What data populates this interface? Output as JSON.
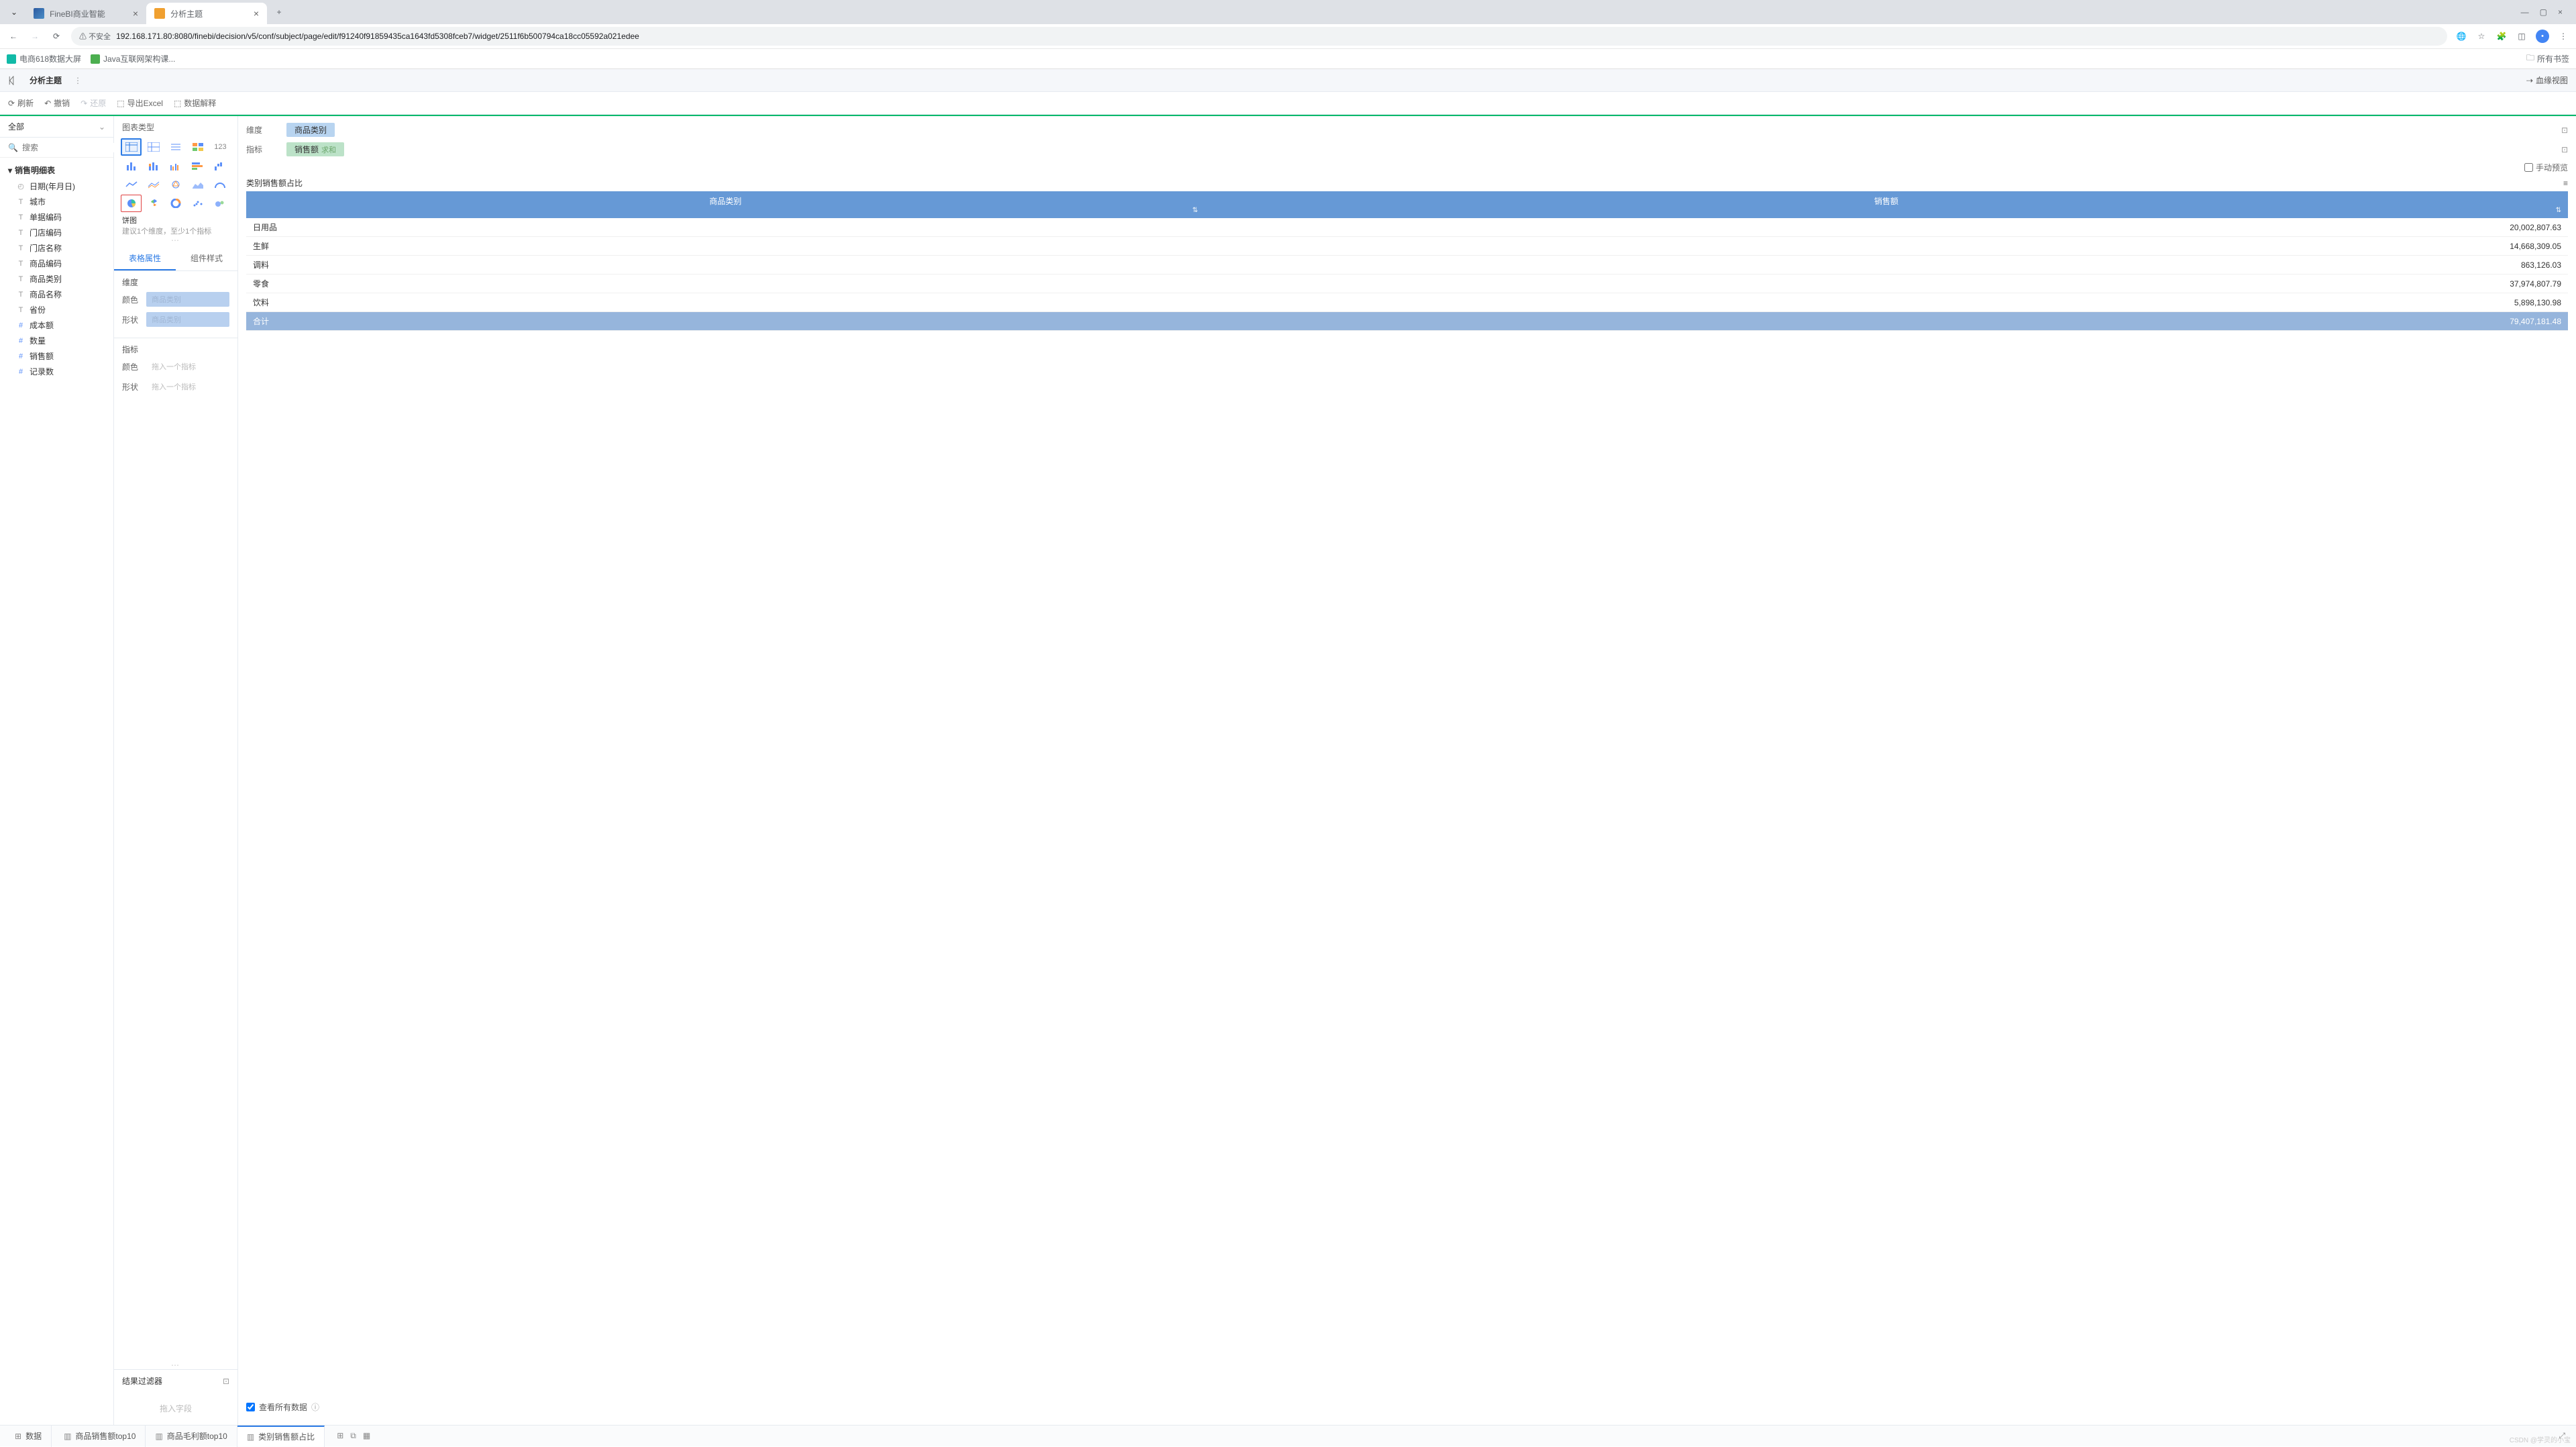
{
  "browser": {
    "tabs": [
      {
        "title": "FineBI商业智能",
        "active": false
      },
      {
        "title": "分析主题",
        "active": true
      }
    ],
    "addr_secure": "不安全",
    "url": "192.168.171.80:8080/finebi/decision/v5/conf/subject/page/edit/f91240f91859435ca1643fd5308fceb7/widget/2511f6b500794ca18cc05592a021edee",
    "bookmarks": [
      {
        "label": "电商618数据大屏",
        "color": "teal"
      },
      {
        "label": "Java互联网架构课...",
        "color": "green"
      }
    ],
    "all_bookmarks": "所有书签"
  },
  "app": {
    "title": "分析主题",
    "lineage": "血缘视图",
    "toolbar": {
      "refresh": "刷新",
      "undo": "撤销",
      "redo": "还原",
      "export": "导出Excel",
      "explain": "数据解释"
    }
  },
  "sidebar": {
    "scope": "全部",
    "search_placeholder": "搜索",
    "dataset": "销售明细表",
    "fields": [
      {
        "icon": "clock",
        "label": "日期(年月日)",
        "type": "dim"
      },
      {
        "icon": "T",
        "label": "城市",
        "type": "dim"
      },
      {
        "icon": "T",
        "label": "单据编码",
        "type": "dim"
      },
      {
        "icon": "T",
        "label": "门店编码",
        "type": "dim"
      },
      {
        "icon": "T",
        "label": "门店名称",
        "type": "dim"
      },
      {
        "icon": "T",
        "label": "商品编码",
        "type": "dim"
      },
      {
        "icon": "T",
        "label": "商品类别",
        "type": "dim"
      },
      {
        "icon": "T",
        "label": "商品名称",
        "type": "dim"
      },
      {
        "icon": "T",
        "label": "省份",
        "type": "dim"
      },
      {
        "icon": "#",
        "label": "成本额",
        "type": "num"
      },
      {
        "icon": "#",
        "label": "数量",
        "type": "num"
      },
      {
        "icon": "#",
        "label": "销售额",
        "type": "num"
      },
      {
        "icon": "#",
        "label": "记录数",
        "type": "num"
      }
    ]
  },
  "chartPanel": {
    "title": "图表类型",
    "selected_name": "饼图",
    "hint": "建议1个维度，至少1个指标",
    "tabs": {
      "attr": "表格属性",
      "style": "组件样式",
      "active": "attr"
    },
    "dim_section": "维度",
    "metric_section": "指标",
    "prop_color": "颜色",
    "prop_shape": "形状",
    "pill_placeholder": "商品类别",
    "drop_placeholder": "拖入一个指标",
    "filter_title": "结果过滤器",
    "filter_placeholder": "拖入字段"
  },
  "canvas": {
    "dim_label": "维度",
    "metric_label": "指标",
    "dim_pill": "商品类别",
    "metric_pill": "销售额",
    "metric_agg": "求和",
    "manual_preview": "手动预览",
    "title": "类别销售额占比",
    "table": {
      "headers": [
        "商品类别",
        "销售额"
      ],
      "rows": [
        {
          "cat": "日用品",
          "val": "20,002,807.63"
        },
        {
          "cat": "生鲜",
          "val": "14,668,309.05"
        },
        {
          "cat": "调料",
          "val": "863,126.03"
        },
        {
          "cat": "零食",
          "val": "37,974,807.79"
        },
        {
          "cat": "饮料",
          "val": "5,898,130.98"
        }
      ],
      "total_label": "合计",
      "total_val": "79,407,181.48"
    },
    "view_all": "查看所有数据"
  },
  "bottomTabs": {
    "data": "数据",
    "tabs": [
      {
        "label": "商品销售额top10",
        "active": false
      },
      {
        "label": "商品毛利额top10",
        "active": false
      },
      {
        "label": "类别销售额占比",
        "active": true
      }
    ]
  },
  "watermark": "CSDN @学灵的小宝"
}
